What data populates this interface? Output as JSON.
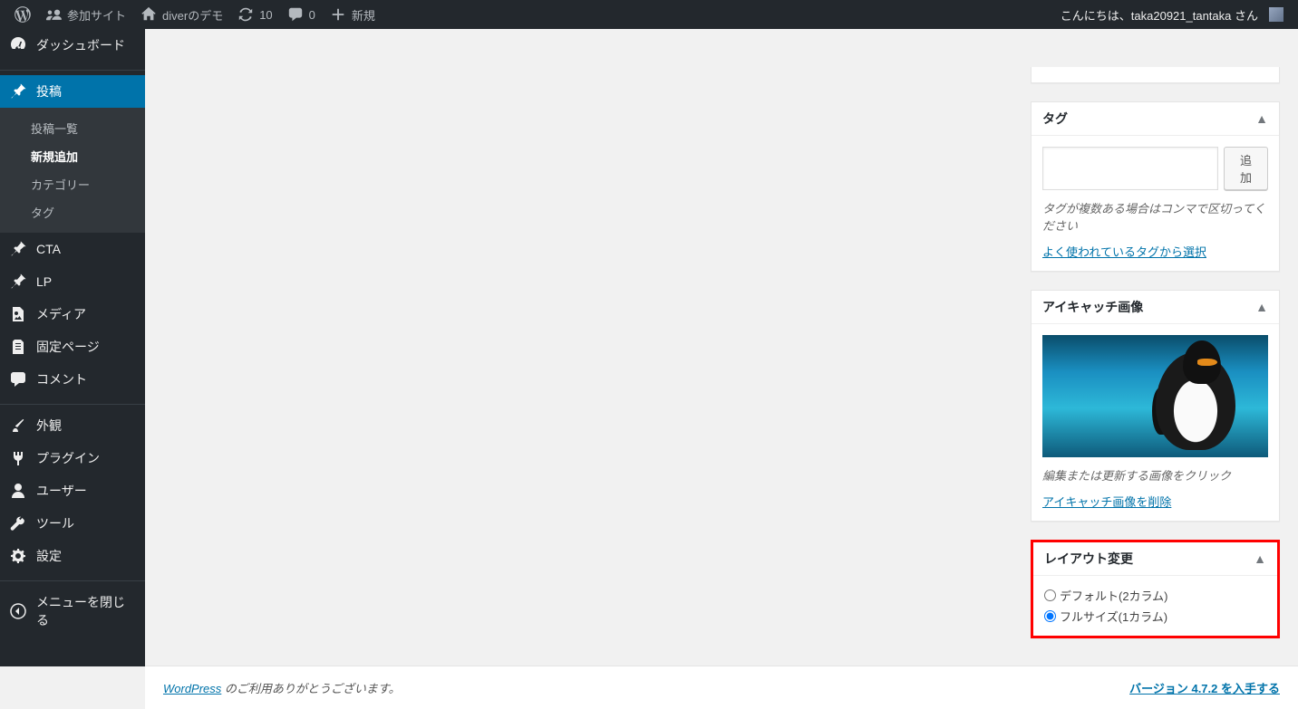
{
  "adminbar": {
    "sites": "参加サイト",
    "site_name": "diverのデモ",
    "updates": "10",
    "comments": "0",
    "new": "新規",
    "greeting": "こんにちは、taka20921_tantaka さん"
  },
  "sidebar": {
    "dashboard": "ダッシュボード",
    "posts": "投稿",
    "posts_sub": {
      "all": "投稿一覧",
      "new": "新規追加",
      "categories": "カテゴリー",
      "tags": "タグ"
    },
    "cta": "CTA",
    "lp": "LP",
    "media": "メディア",
    "pages": "固定ページ",
    "comments": "コメント",
    "appearance": "外観",
    "plugins": "プラグイン",
    "users": "ユーザー",
    "tools": "ツール",
    "settings": "設定",
    "collapse": "メニューを閉じる"
  },
  "metabox": {
    "tags": {
      "title": "タグ",
      "add_btn": "追加",
      "howto": "タグが複数ある場合はコンマで区切ってください",
      "choose_link": "よく使われているタグから選択"
    },
    "featured": {
      "title": "アイキャッチ画像",
      "howto": "編集または更新する画像をクリック",
      "remove_link": "アイキャッチ画像を削除"
    },
    "layout": {
      "title": "レイアウト変更",
      "option_default": "デフォルト(2カラム)",
      "option_full": "フルサイズ(1カラム)"
    }
  },
  "footer": {
    "thanks_link": "WordPress",
    "thanks_text": " のご利用ありがとうございます。",
    "version": "バージョン 4.7.2 を入手する"
  }
}
